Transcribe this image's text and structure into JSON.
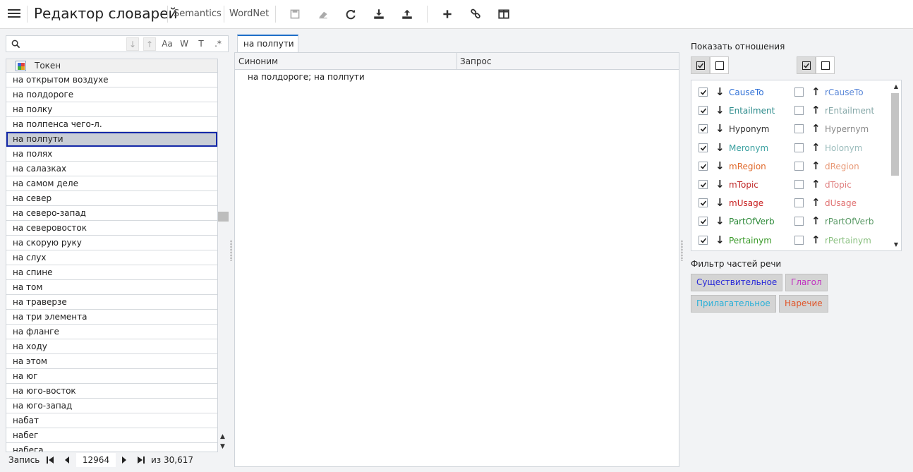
{
  "header": {
    "title": "Редактор словарей",
    "tabs": [
      "Semantics",
      "WordNet"
    ]
  },
  "search": {
    "placeholder": "",
    "options": [
      "Aa",
      "W",
      "T",
      ".*"
    ]
  },
  "token_list": {
    "column_header": "Токен",
    "rows": [
      "на открытом воздухе",
      "на полдороге",
      "на полку",
      "на полпенса чего-л.",
      "на полпути",
      "на полях",
      "на салазках",
      "на самом деле",
      "на север",
      "на северо-запад",
      "на северовосток",
      "на скорую руку",
      "на слух",
      "на спине",
      "на том",
      "на траверзе",
      "на три элемента",
      "на фланге",
      "на ходу",
      "на этом",
      "на юг",
      "на юго-восток",
      "на юго-запад",
      "набат",
      "набег",
      "набега"
    ],
    "selected_row": "на полпути"
  },
  "pager": {
    "label": "Запись",
    "current": "12964",
    "total": "из 30,617"
  },
  "document": {
    "tab": "на полпути",
    "columns": [
      "Синоним",
      "Запрос"
    ],
    "synonym_value": "на полдороге; на полпути"
  },
  "relations": {
    "title": "Показать отношения",
    "rows": [
      {
        "name": "CauseTo",
        "color": "#2e6fd6",
        "rname": "rCauseTo",
        "rcolor": "#5b88d8",
        "checked": true
      },
      {
        "name": "Entailment",
        "color": "#2a8a8a",
        "rname": "rEntailment",
        "rcolor": "#86a8a8",
        "checked": true
      },
      {
        "name": "Hyponym",
        "color": "#333333",
        "rname": "Hypernym",
        "rcolor": "#8a8a8a",
        "checked": true
      },
      {
        "name": "Meronym",
        "color": "#3aa0a0",
        "rname": "Holonym",
        "rcolor": "#9bbcbc",
        "checked": true
      },
      {
        "name": "mRegion",
        "color": "#e06a2c",
        "rname": "dRegion",
        "rcolor": "#e89a78",
        "checked": true
      },
      {
        "name": "mTopic",
        "color": "#c02a2a",
        "rname": "dTopic",
        "rcolor": "#e08080",
        "checked": true
      },
      {
        "name": "mUsage",
        "color": "#c81e1e",
        "rname": "dUsage",
        "rcolor": "#e07070",
        "checked": true
      },
      {
        "name": "PartOfVerb",
        "color": "#2e8a3a",
        "rname": "rPartOfVerb",
        "rcolor": "#5a9a66",
        "checked": true
      },
      {
        "name": "Pertainym",
        "color": "#3a9a2a",
        "rname": "rPertainym",
        "rcolor": "#8ac080",
        "checked": true
      }
    ]
  },
  "pos_filter": {
    "title": "Фильтр частей речи",
    "buttons": [
      {
        "label": "Существительное",
        "color": "#2a2ad8"
      },
      {
        "label": "Глагол",
        "color": "#c030c0"
      },
      {
        "label": "Прилагательное",
        "color": "#2ab0d8"
      },
      {
        "label": "Наречие",
        "color": "#e0562a"
      }
    ]
  }
}
